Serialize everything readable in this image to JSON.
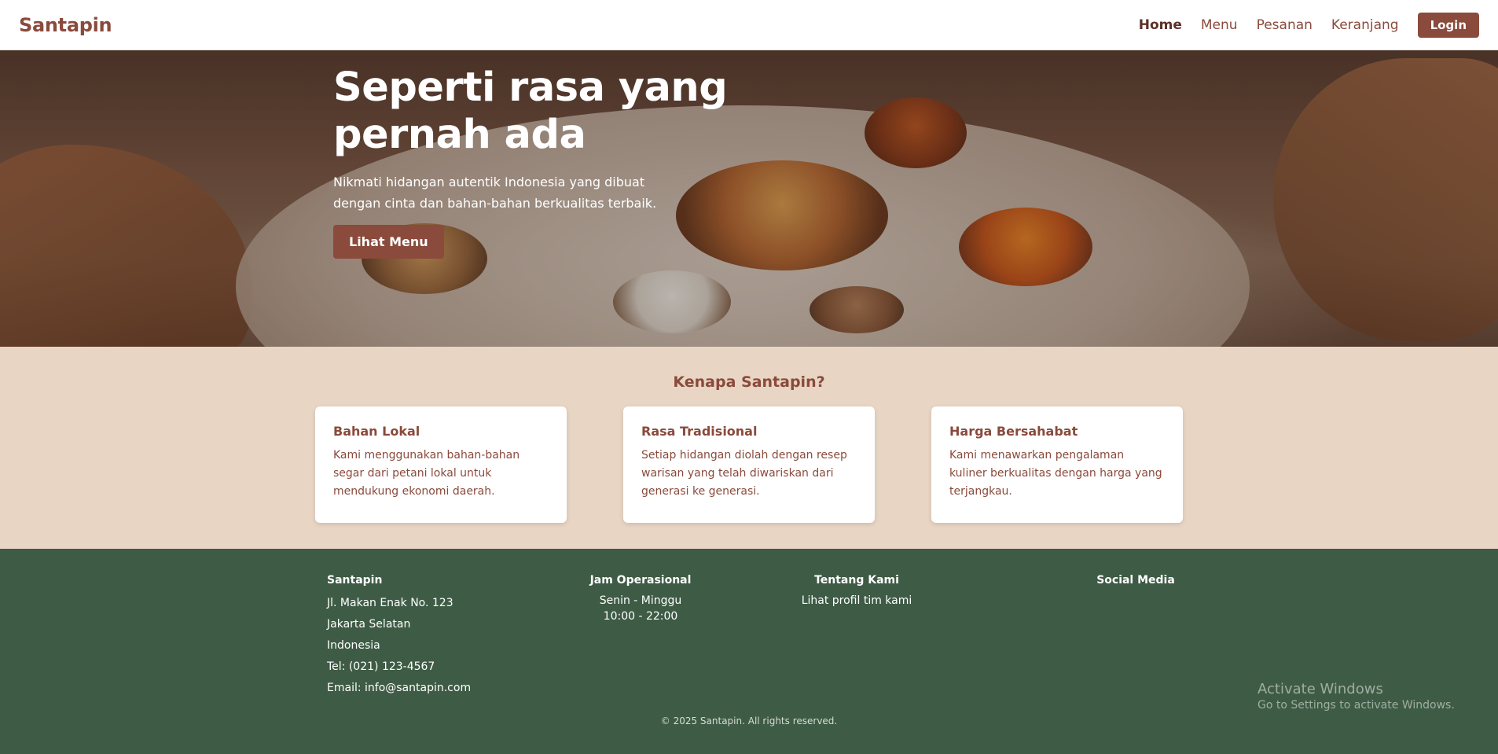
{
  "nav": {
    "brand": "Santapin",
    "links": [
      "Home",
      "Menu",
      "Pesanan",
      "Keranjang"
    ],
    "active": "Home",
    "login_label": "Login"
  },
  "hero": {
    "title": "Seperti rasa yang pernah ada",
    "subtitle": "Nikmati hidangan autentik Indonesia yang dibuat dengan cinta dan bahan-bahan berkualitas terbaik.",
    "button_label": "Lihat Menu"
  },
  "why": {
    "title": "Kenapa Santapin?",
    "cards": [
      {
        "title": "Bahan Lokal",
        "text": "Kami menggunakan bahan-bahan segar dari petani lokal untuk mendukung ekonomi daerah."
      },
      {
        "title": "Rasa Tradisional",
        "text": "Setiap hidangan diolah dengan resep warisan yang telah diwariskan dari generasi ke generasi."
      },
      {
        "title": "Harga Bersahabat",
        "text": "Kami menawarkan pengalaman kuliner berkualitas dengan harga yang terjangkau."
      }
    ]
  },
  "footer": {
    "brand": "Santapin",
    "address": [
      "Jl. Makan Enak No. 123",
      "Jakarta Selatan",
      "Indonesia",
      "Tel: (021) 123-4567",
      "Email: info@santapin.com"
    ],
    "hours_title": "Jam Operasional",
    "hours": [
      "Senin - Minggu",
      "10:00 - 22:00"
    ],
    "about_title": "Tentang Kami",
    "about_link": "Lihat profil tim kami",
    "social_title": "Social Media",
    "copyright": "© 2025 Santapin. All rights reserved."
  },
  "overlay": {
    "activate_title": "Activate Windows",
    "activate_sub": "Go to Settings to activate Windows."
  },
  "colors": {
    "brand": "#8a4a3c",
    "section_bg": "#e8d5c4",
    "footer_bg": "#3e5b45"
  }
}
